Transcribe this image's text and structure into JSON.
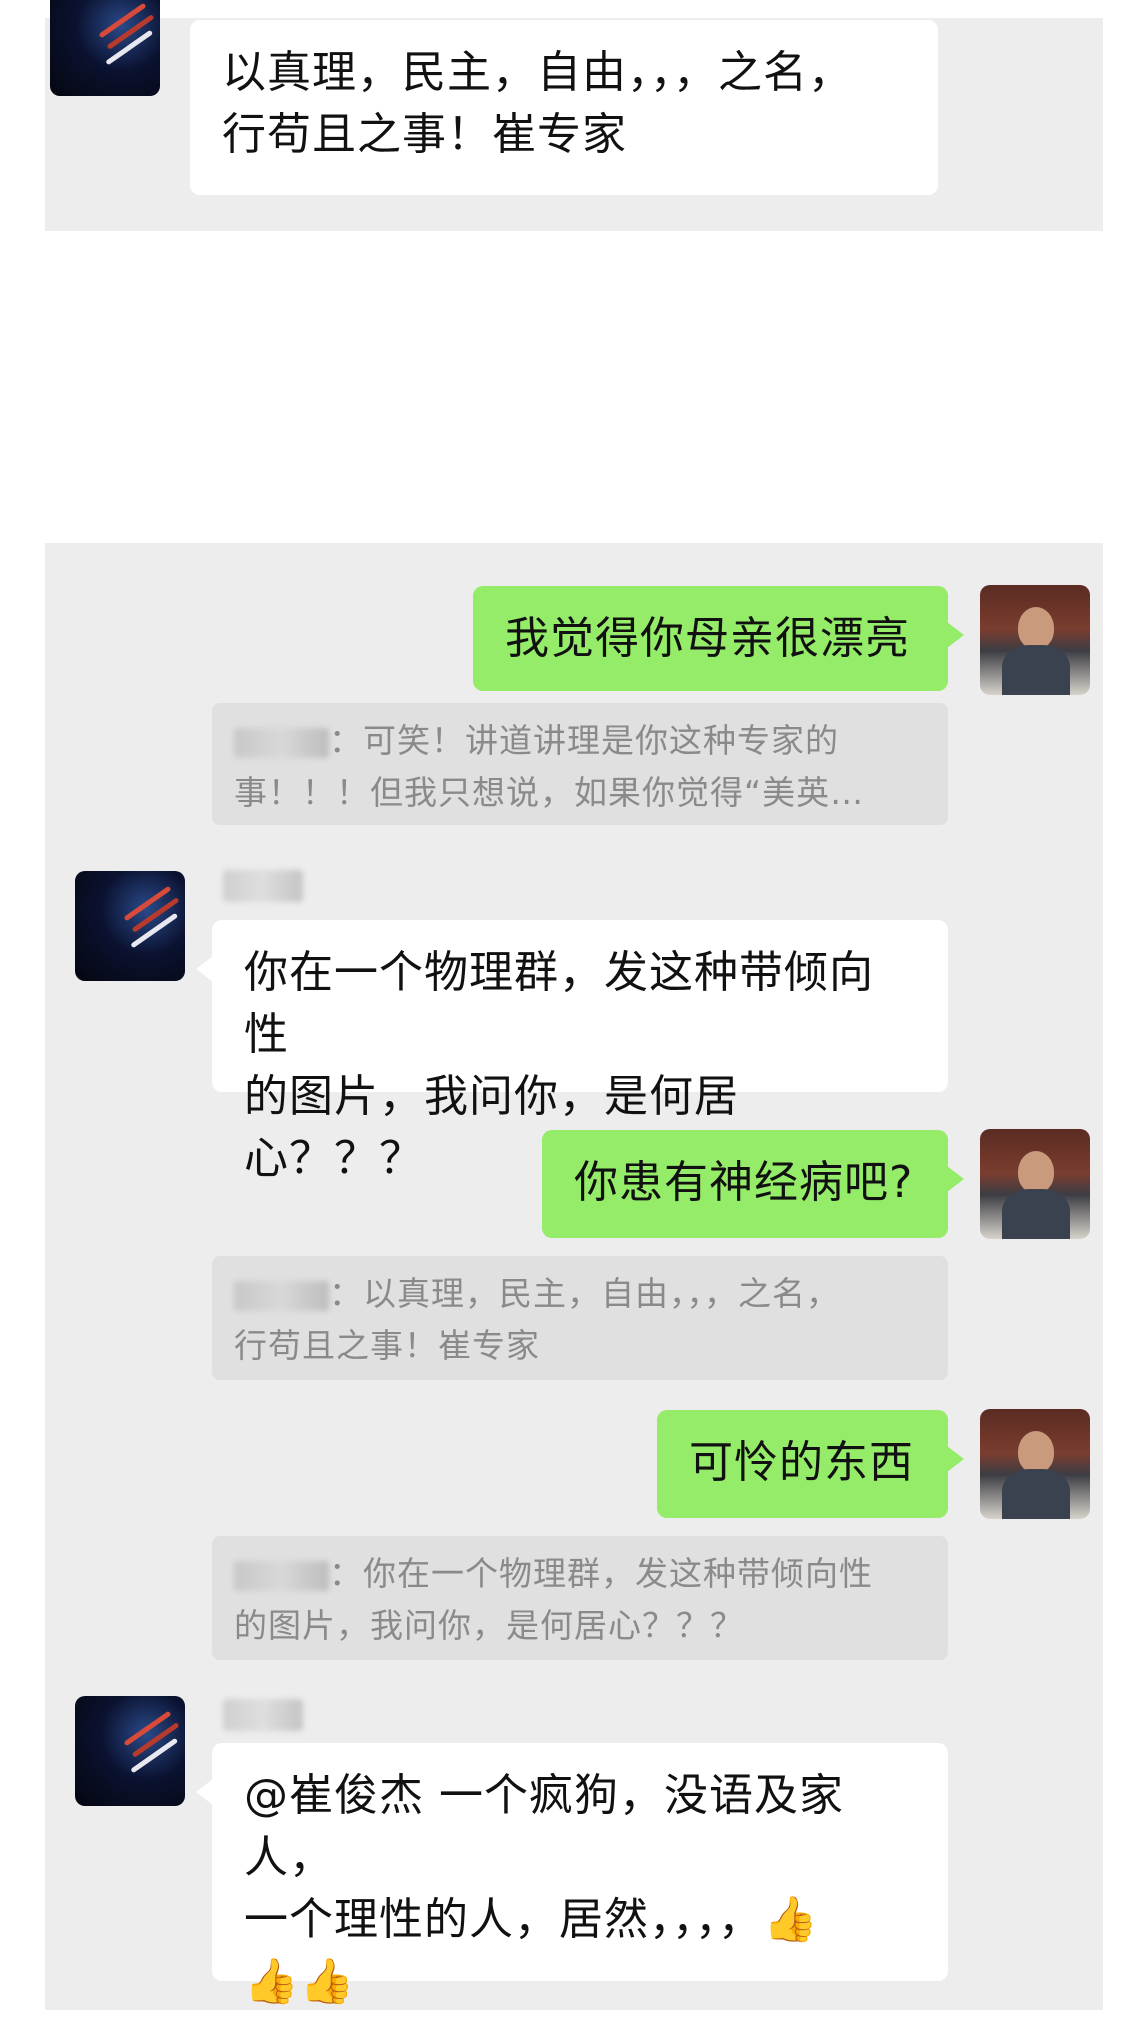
{
  "top_message": {
    "line1": "以真理，民主，自由，，，之名，",
    "line2": "行苟且之事！崔专家"
  },
  "messages": [
    {
      "type": "outgoing",
      "text": "我觉得你母亲很漂亮"
    },
    {
      "type": "quote",
      "line1": "：可笑！讲道讲理是你这种专家的",
      "line2": "事！！！但我只想说，如果你觉得“美英…"
    },
    {
      "type": "incoming",
      "line1": "你在一个物理群，发这种带倾向性",
      "line2": "的图片，我问你，是何居心？？？"
    },
    {
      "type": "outgoing",
      "text": "你患有神经病吧?"
    },
    {
      "type": "quote",
      "line1": "：以真理，民主，自由，，，之名，",
      "line2": "行苟且之事！崔专家"
    },
    {
      "type": "outgoing",
      "text": "可怜的东西"
    },
    {
      "type": "quote",
      "line1": "：你在一个物理群，发这种带倾向性",
      "line2": "的图片，我问你，是何居心？？？"
    },
    {
      "type": "incoming",
      "line1": "@崔俊杰 一个疯狗，没语及家人，",
      "line2": "一个理性的人，居然，，，，",
      "emoji": "👍",
      "line3": "👍👍"
    }
  ],
  "icons": {
    "other_avatar": "dark-avatar-icon",
    "self_avatar": "person-avatar-icon",
    "thumbs_up": "thumbs-up-icon"
  },
  "colors": {
    "outgoing_bubble": "#95ec69",
    "incoming_bubble": "#ffffff",
    "chat_background": "#ededed",
    "quote_background": "#e0e0e0"
  }
}
